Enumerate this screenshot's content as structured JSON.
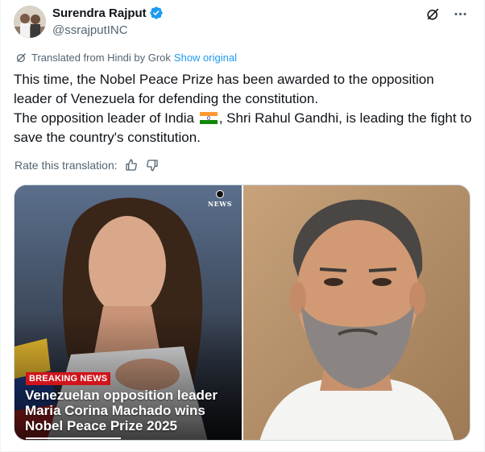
{
  "author": {
    "display_name": "Surendra Rajput",
    "handle": "@ssrajputINC",
    "verified": true,
    "verified_color": "#1d9bf0"
  },
  "translation": {
    "notice": "Translated from Hindi by Grok",
    "show_original_label": "Show original",
    "rate_label": "Rate this translation:"
  },
  "post": {
    "paragraph1": "This time, the Nobel Peace Prize has been awarded to the opposition leader of Venezuela for defending the constitution.",
    "paragraph2_before_flag": "The opposition leader of India",
    "paragraph2_after_flag": ", Shri Rahul Gandhi, is leading the fight to save the country's constitution."
  },
  "media": {
    "left": {
      "network_label": "NEWS",
      "badge": "BREAKING NEWS",
      "headline": "Venezuelan opposition leader Maria Corina Machado wins Nobel Peace Prize 2025"
    }
  },
  "icons": {
    "grok": "grok-icon",
    "more": "more-icon",
    "translate": "translate-icon",
    "thumbs_up": "thumbs-up-icon",
    "thumbs_down": "thumbs-down-icon",
    "flag": "india-flag-icon"
  },
  "colors": {
    "text_primary": "#0f1419",
    "text_secondary": "#536471",
    "link": "#1d9bf0",
    "breaking_red": "#d0141b"
  }
}
